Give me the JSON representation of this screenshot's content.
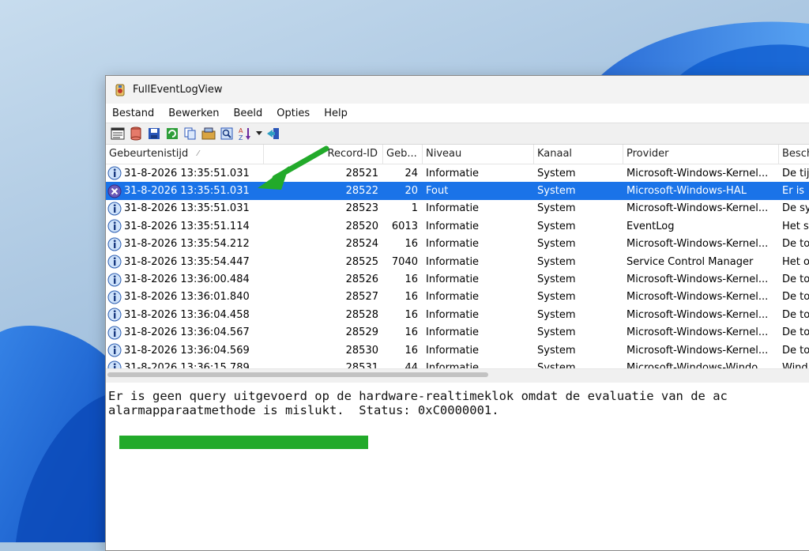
{
  "window": {
    "title": "FullEventLogView"
  },
  "menu": [
    "Bestand",
    "Bewerken",
    "Beeld",
    "Opties",
    "Help"
  ],
  "toolbar_icons": [
    "properties-icon",
    "database-icon",
    "save-icon",
    "refresh-icon",
    "copy-icon",
    "advanced-options-icon",
    "find-icon",
    "sort-icon",
    "dropdown-icon",
    "exit-icon"
  ],
  "columns": [
    "Gebeurtenistijd",
    "Record-ID",
    "Geb...",
    "Niveau",
    "Kanaal",
    "Provider",
    "Besch"
  ],
  "rows": [
    {
      "time": "31-8-2026 13:35:51.031",
      "record": "28521",
      "event": "24",
      "level": "Informatie",
      "channel": "System",
      "provider": "Microsoft-Windows-Kernel...",
      "desc": "De tij",
      "icon": "info"
    },
    {
      "time": "31-8-2026 13:35:51.031",
      "record": "28522",
      "event": "20",
      "level": "Fout",
      "channel": "System",
      "provider": "Microsoft-Windows-HAL",
      "desc": "Er is",
      "icon": "error",
      "selected": true
    },
    {
      "time": "31-8-2026 13:35:51.031",
      "record": "28523",
      "event": "1",
      "level": "Informatie",
      "channel": "System",
      "provider": "Microsoft-Windows-Kernel...",
      "desc": "De sy",
      "icon": "info"
    },
    {
      "time": "31-8-2026 13:35:51.114",
      "record": "28520",
      "event": "6013",
      "level": "Informatie",
      "channel": "System",
      "provider": "EventLog",
      "desc": "Het s",
      "icon": "info"
    },
    {
      "time": "31-8-2026 13:35:54.212",
      "record": "28524",
      "event": "16",
      "level": "Informatie",
      "channel": "System",
      "provider": "Microsoft-Windows-Kernel...",
      "desc": "De to",
      "icon": "info"
    },
    {
      "time": "31-8-2026 13:35:54.447",
      "record": "28525",
      "event": "7040",
      "level": "Informatie",
      "channel": "System",
      "provider": "Service Control Manager",
      "desc": "Het o",
      "icon": "info"
    },
    {
      "time": "31-8-2026 13:36:00.484",
      "record": "28526",
      "event": "16",
      "level": "Informatie",
      "channel": "System",
      "provider": "Microsoft-Windows-Kernel...",
      "desc": "De to",
      "icon": "info"
    },
    {
      "time": "31-8-2026 13:36:01.840",
      "record": "28527",
      "event": "16",
      "level": "Informatie",
      "channel": "System",
      "provider": "Microsoft-Windows-Kernel...",
      "desc": "De to",
      "icon": "info"
    },
    {
      "time": "31-8-2026 13:36:04.458",
      "record": "28528",
      "event": "16",
      "level": "Informatie",
      "channel": "System",
      "provider": "Microsoft-Windows-Kernel...",
      "desc": "De to",
      "icon": "info"
    },
    {
      "time": "31-8-2026 13:36:04.567",
      "record": "28529",
      "event": "16",
      "level": "Informatie",
      "channel": "System",
      "provider": "Microsoft-Windows-Kernel...",
      "desc": "De to",
      "icon": "info"
    },
    {
      "time": "31-8-2026 13:36:04.569",
      "record": "28530",
      "event": "16",
      "level": "Informatie",
      "channel": "System",
      "provider": "Microsoft-Windows-Kernel...",
      "desc": "De to",
      "icon": "info"
    },
    {
      "time": "31-8-2026 13:36:15.789",
      "record": "28531",
      "event": "44",
      "level": "Informatie",
      "channel": "System",
      "provider": "Microsoft-Windows-Windo...",
      "desc": "Wind",
      "icon": "info"
    }
  ],
  "details": {
    "text": "Er is geen query uitgevoerd op de hardware-realtimeklok omdat de evaluatie van de ac\nalarmapparaatmethode is mislukt.  Status: 0xC0000001."
  },
  "colors": {
    "selection": "#1a73e8",
    "annotation_green": "#22aa2a"
  }
}
